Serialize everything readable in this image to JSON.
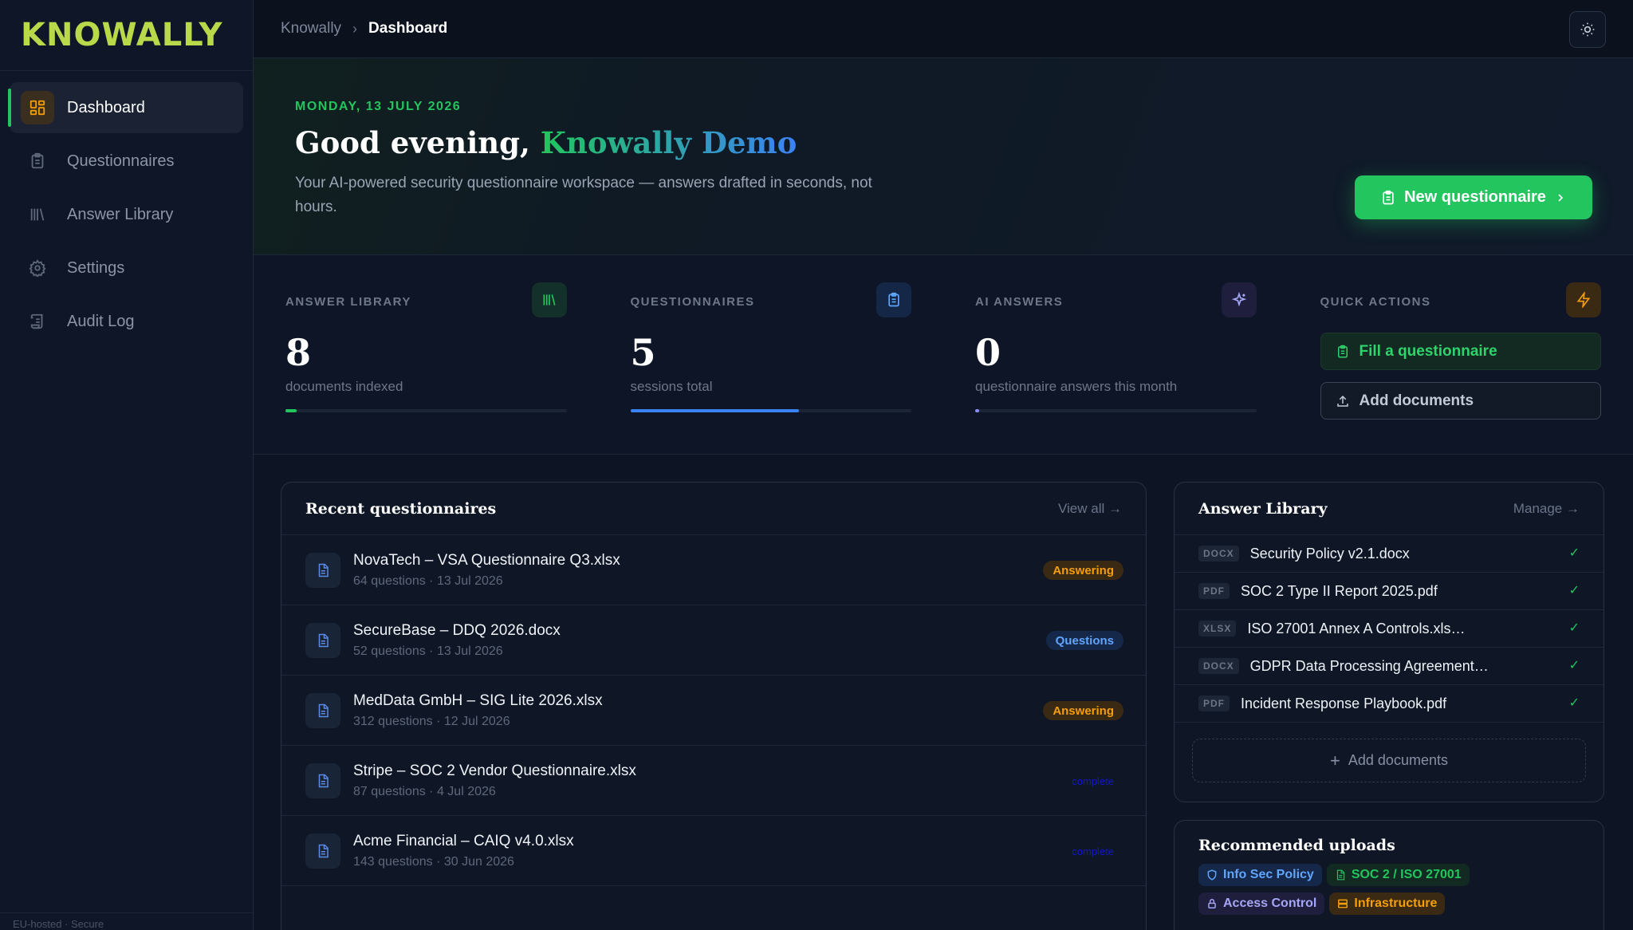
{
  "app": {
    "logo": "KNOWALLY"
  },
  "sidebar": {
    "items": [
      {
        "label": "Dashboard"
      },
      {
        "label": "Questionnaires"
      },
      {
        "label": "Answer Library"
      },
      {
        "label": "Settings"
      },
      {
        "label": "Audit Log"
      }
    ],
    "footer": "EU-hosted · Secure"
  },
  "breadcrumb": {
    "root": "Knowally",
    "current": "Dashboard"
  },
  "hero": {
    "date": "MONDAY, 13 JULY 2026",
    "greeting": "Good evening,",
    "name": "Knowally Demo",
    "subtitle": "Your AI-powered security questionnaire workspace — answers drafted in seconds, not hours.",
    "cta": "New questionnaire"
  },
  "stats": [
    {
      "label": "ANSWER LIBRARY",
      "value": "8",
      "caption": "documents indexed",
      "progress": 0.04,
      "color": "#22c55e"
    },
    {
      "label": "QUESTIONNAIRES",
      "value": "5",
      "caption": "sessions total",
      "progress": 0.6,
      "color": "#3b82f6"
    },
    {
      "label": "AI ANSWERS",
      "value": "0",
      "caption": "questionnaire answers this month",
      "progress": 0.015,
      "color": "#8b8cf6"
    }
  ],
  "quick_actions": {
    "label": "QUICK ACTIONS",
    "fill": "Fill a questionnaire",
    "add": "Add documents"
  },
  "recent": {
    "title": "Recent questionnaires",
    "link": "View all →",
    "rows": [
      {
        "name": "NovaTech – VSA Questionnaire Q3.xlsx",
        "meta": "64 questions · 13 Jul 2026",
        "status": "Answering",
        "kind": "answering"
      },
      {
        "name": "SecureBase – DDQ 2026.docx",
        "meta": "52 questions · 13 Jul 2026",
        "status": "Questions",
        "kind": "questions"
      },
      {
        "name": "MedData GmbH – SIG Lite 2026.xlsx",
        "meta": "312 questions · 12 Jul 2026",
        "status": "Answering",
        "kind": "answering"
      },
      {
        "name": "Stripe – SOC 2 Vendor Questionnaire.xlsx",
        "meta": "87 questions · 4 Jul 2026",
        "status": "complete",
        "kind": "complete"
      },
      {
        "name": "Acme Financial – CAIQ v4.0.xlsx",
        "meta": "143 questions · 30 Jun 2026",
        "status": "complete",
        "kind": "complete"
      }
    ]
  },
  "library": {
    "title": "Answer Library",
    "link": "Manage →",
    "docs": [
      {
        "type": "DOCX",
        "name": "Security Policy v2.1.docx"
      },
      {
        "type": "PDF",
        "name": "SOC 2 Type II Report 2025.pdf"
      },
      {
        "type": "XLSX",
        "name": "ISO 27001 Annex A Controls.xls…"
      },
      {
        "type": "DOCX",
        "name": "GDPR Data Processing Agreement…"
      },
      {
        "type": "PDF",
        "name": "Incident Response Playbook.pdf"
      }
    ],
    "add_label": "Add documents"
  },
  "recommended": {
    "title": "Recommended uploads",
    "chips": [
      {
        "label": "Info Sec Policy",
        "color": "#60a5fa",
        "bg": "#15284a"
      },
      {
        "label": "SOC 2 / ISO 27001",
        "color": "#22c55e",
        "bg": "#132a22"
      },
      {
        "label": "Access Control",
        "color": "#a5a6f6",
        "bg": "#1f1f3d"
      },
      {
        "label": "Infrastructure",
        "color": "#f59e0b",
        "bg": "#3a2a14"
      }
    ]
  }
}
